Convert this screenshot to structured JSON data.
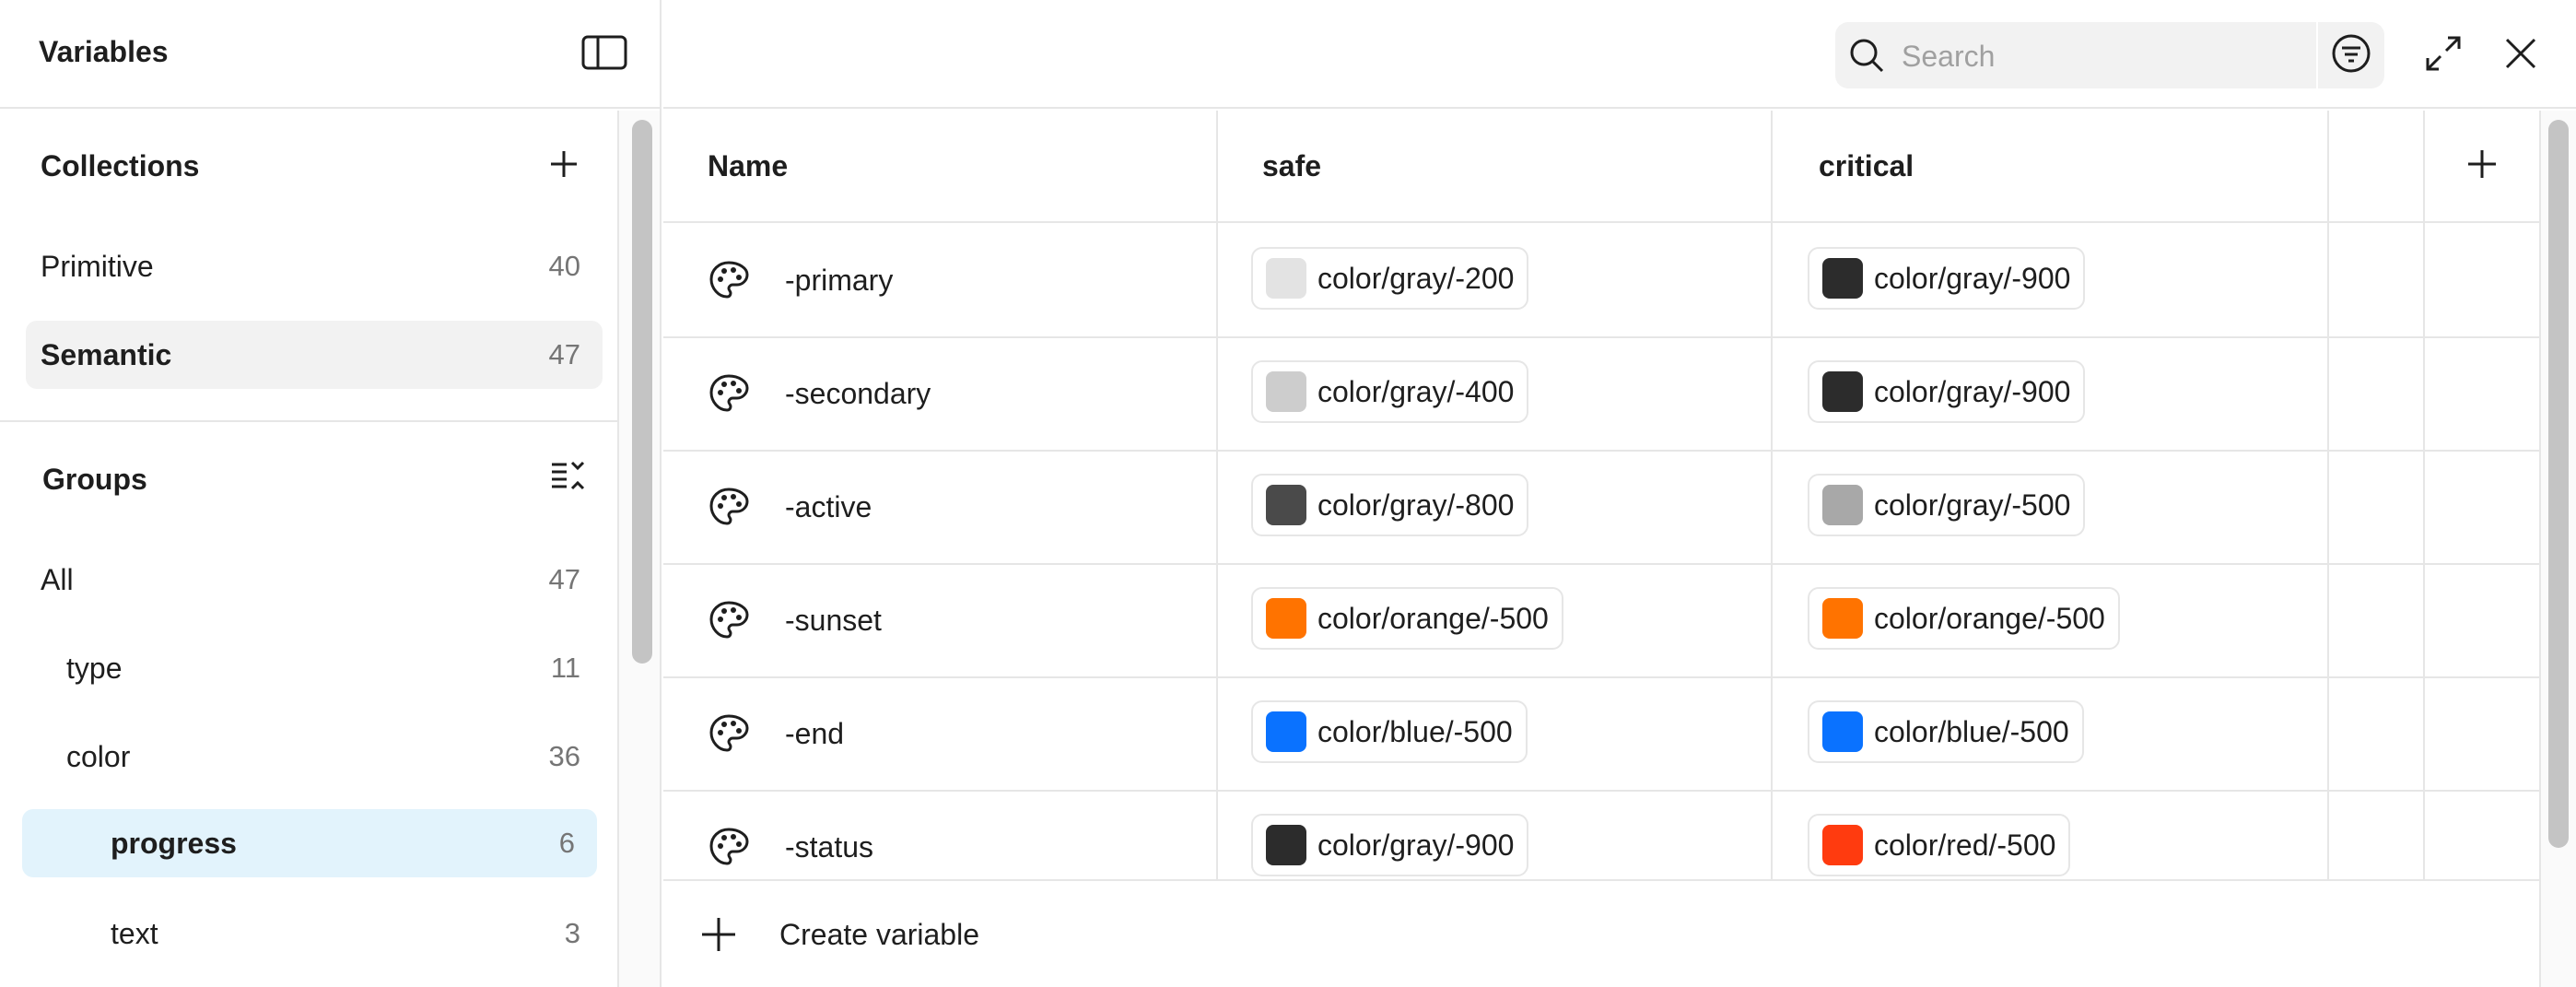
{
  "sidebar": {
    "title": "Variables",
    "collections": {
      "title": "Collections",
      "items": [
        {
          "label": "Primitive",
          "count": "40"
        },
        {
          "label": "Semantic",
          "count": "47"
        }
      ]
    },
    "groups": {
      "title": "Groups",
      "items": [
        {
          "label": "All",
          "count": "47"
        },
        {
          "label": "type",
          "count": "11"
        },
        {
          "label": "color",
          "count": "36"
        },
        {
          "label": "progress",
          "count": "6"
        },
        {
          "label": "text",
          "count": "3"
        }
      ]
    }
  },
  "toolbar": {
    "search_placeholder": "Search"
  },
  "table": {
    "columns": [
      "Name",
      "safe",
      "critical"
    ],
    "rows": [
      {
        "name": "-primary",
        "safe": {
          "label": "color/gray/-200",
          "color": "#e3e3e3"
        },
        "critical": {
          "label": "color/gray/-900",
          "color": "#2c2c2c"
        }
      },
      {
        "name": "-secondary",
        "safe": {
          "label": "color/gray/-400",
          "color": "#cdcdcd"
        },
        "critical": {
          "label": "color/gray/-900",
          "color": "#2c2c2c"
        }
      },
      {
        "name": "-active",
        "safe": {
          "label": "color/gray/-800",
          "color": "#4a4a4a"
        },
        "critical": {
          "label": "color/gray/-500",
          "color": "#a8a8a8"
        }
      },
      {
        "name": "-sunset",
        "safe": {
          "label": "color/orange/-500",
          "color": "#ff7300"
        },
        "critical": {
          "label": "color/orange/-500",
          "color": "#ff7300"
        }
      },
      {
        "name": "-end",
        "safe": {
          "label": "color/blue/-500",
          "color": "#0a72ff"
        },
        "critical": {
          "label": "color/blue/-500",
          "color": "#0a72ff"
        }
      },
      {
        "name": "-status",
        "safe": {
          "label": "color/gray/-900",
          "color": "#2c2c2c"
        },
        "critical": {
          "label": "color/red/-500",
          "color": "#ff3b0f"
        }
      }
    ],
    "create_label": "Create variable"
  }
}
